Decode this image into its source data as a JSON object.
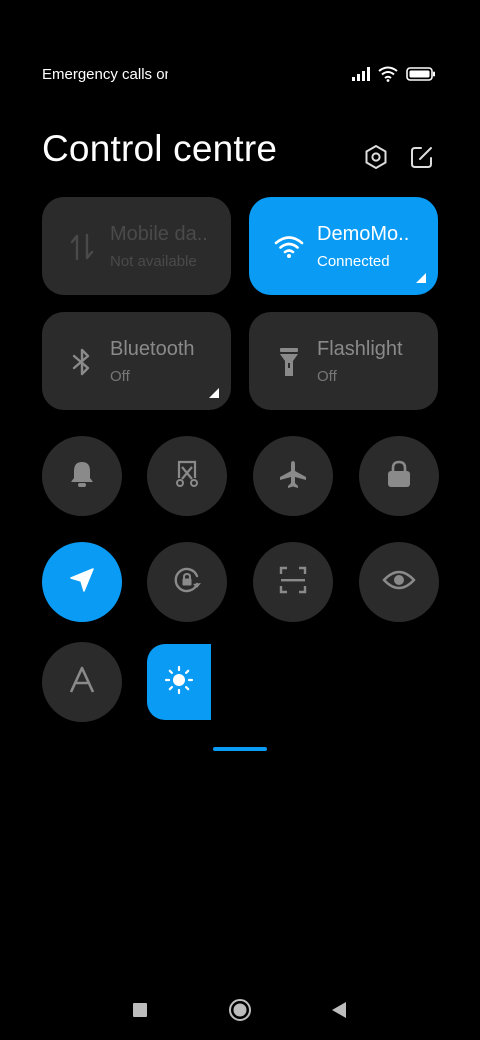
{
  "status_bar": {
    "text": "Emergency calls only",
    "icons": [
      "signal-icon",
      "wifi-icon",
      "battery-icon"
    ]
  },
  "header": {
    "title": "Control centre",
    "icons": [
      "settings-icon",
      "edit-icon"
    ]
  },
  "tiles": {
    "mobile_data": {
      "title": "Mobile da..",
      "subtitle": "Not available",
      "icon": "data-arrows-icon",
      "state": "disabled"
    },
    "wifi": {
      "title": "DemoMo..",
      "subtitle": "Connected",
      "icon": "wifi-icon",
      "state": "active"
    },
    "bluetooth": {
      "title": "Bluetooth",
      "subtitle": "Off",
      "icon": "bluetooth-icon",
      "state": "off"
    },
    "flashlight": {
      "title": "Flashlight",
      "subtitle": "Off",
      "icon": "flashlight-icon",
      "state": "off"
    }
  },
  "toggles": [
    {
      "name": "silent",
      "icon": "bell-icon",
      "active": false
    },
    {
      "name": "screenshot",
      "icon": "scissors-screenshot-icon",
      "active": false
    },
    {
      "name": "airplane-mode",
      "icon": "airplane-icon",
      "active": false
    },
    {
      "name": "lock-screen",
      "icon": "lock-icon",
      "active": false
    },
    {
      "name": "location",
      "icon": "location-arrow-icon",
      "active": true
    },
    {
      "name": "auto-rotate",
      "icon": "rotate-lock-icon",
      "active": false
    },
    {
      "name": "scanner",
      "icon": "scan-frame-icon",
      "active": false
    },
    {
      "name": "reading-mode",
      "icon": "eye-icon",
      "active": false
    },
    {
      "name": "auto-brightness",
      "icon": "font-a-icon",
      "active": false
    }
  ],
  "brightness": {
    "icon": "sun-icon"
  },
  "navigation": {
    "icons": [
      "recents-square-icon",
      "home-circle-icon",
      "back-triangle-icon"
    ]
  },
  "colors": {
    "accent": "#0a9bf5",
    "tile": "#2b2b2b",
    "background": "#000000"
  }
}
